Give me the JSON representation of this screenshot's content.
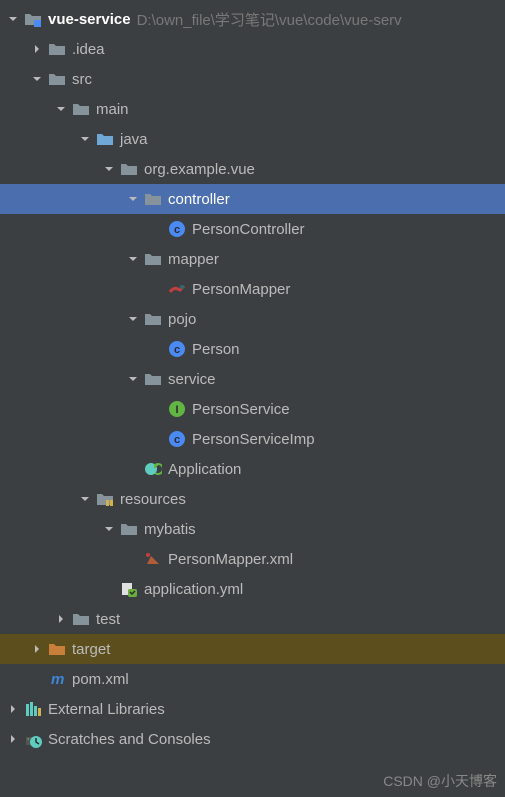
{
  "root": {
    "name": "vue-service",
    "path": "D:\\own_file\\学习笔记\\vue\\code\\vue-serv"
  },
  "tree": [
    {
      "id": "root",
      "label": "vue-service",
      "indent": 0,
      "arrow": "open",
      "icon": "project-folder",
      "isRoot": true
    },
    {
      "id": "idea",
      "label": ".idea",
      "indent": 1,
      "arrow": "closed",
      "icon": "folder"
    },
    {
      "id": "src",
      "label": "src",
      "indent": 1,
      "arrow": "open",
      "icon": "folder"
    },
    {
      "id": "main",
      "label": "main",
      "indent": 2,
      "arrow": "open",
      "icon": "folder"
    },
    {
      "id": "java",
      "label": "java",
      "indent": 3,
      "arrow": "open",
      "icon": "src-folder"
    },
    {
      "id": "pkg",
      "label": "org.example.vue",
      "indent": 4,
      "arrow": "open",
      "icon": "package"
    },
    {
      "id": "controller",
      "label": "controller",
      "indent": 5,
      "arrow": "open",
      "icon": "package",
      "selected": true
    },
    {
      "id": "pc",
      "label": "PersonController",
      "indent": 6,
      "arrow": "none",
      "icon": "class"
    },
    {
      "id": "mapper",
      "label": "mapper",
      "indent": 5,
      "arrow": "open",
      "icon": "package"
    },
    {
      "id": "pm",
      "label": "PersonMapper",
      "indent": 6,
      "arrow": "none",
      "icon": "mapper"
    },
    {
      "id": "pojo",
      "label": "pojo",
      "indent": 5,
      "arrow": "open",
      "icon": "package"
    },
    {
      "id": "person",
      "label": "Person",
      "indent": 6,
      "arrow": "none",
      "icon": "class"
    },
    {
      "id": "service",
      "label": "service",
      "indent": 5,
      "arrow": "open",
      "icon": "package"
    },
    {
      "id": "ps",
      "label": "PersonService",
      "indent": 6,
      "arrow": "none",
      "icon": "interface"
    },
    {
      "id": "psi",
      "label": "PersonServiceImp",
      "indent": 6,
      "arrow": "none",
      "icon": "class"
    },
    {
      "id": "app",
      "label": "Application",
      "indent": 5,
      "arrow": "none",
      "icon": "app"
    },
    {
      "id": "resources",
      "label": "resources",
      "indent": 3,
      "arrow": "open",
      "icon": "res-folder"
    },
    {
      "id": "mybatis",
      "label": "mybatis",
      "indent": 4,
      "arrow": "open",
      "icon": "folder"
    },
    {
      "id": "pmxml",
      "label": "PersonMapper.xml",
      "indent": 5,
      "arrow": "none",
      "icon": "xml"
    },
    {
      "id": "appyml",
      "label": "application.yml",
      "indent": 4,
      "arrow": "none",
      "icon": "yml"
    },
    {
      "id": "test",
      "label": "test",
      "indent": 2,
      "arrow": "closed",
      "icon": "folder"
    },
    {
      "id": "target",
      "label": "target",
      "indent": 1,
      "arrow": "closed",
      "icon": "target-folder",
      "target": true
    },
    {
      "id": "pom",
      "label": "pom.xml",
      "indent": 1,
      "arrow": "none",
      "icon": "pom"
    },
    {
      "id": "ext",
      "label": "External Libraries",
      "indent": 0,
      "arrow": "closed",
      "icon": "libs"
    },
    {
      "id": "scratch",
      "label": "Scratches and Consoles",
      "indent": 0,
      "arrow": "closed",
      "icon": "scratch"
    }
  ],
  "watermark": "CSDN @小天博客"
}
